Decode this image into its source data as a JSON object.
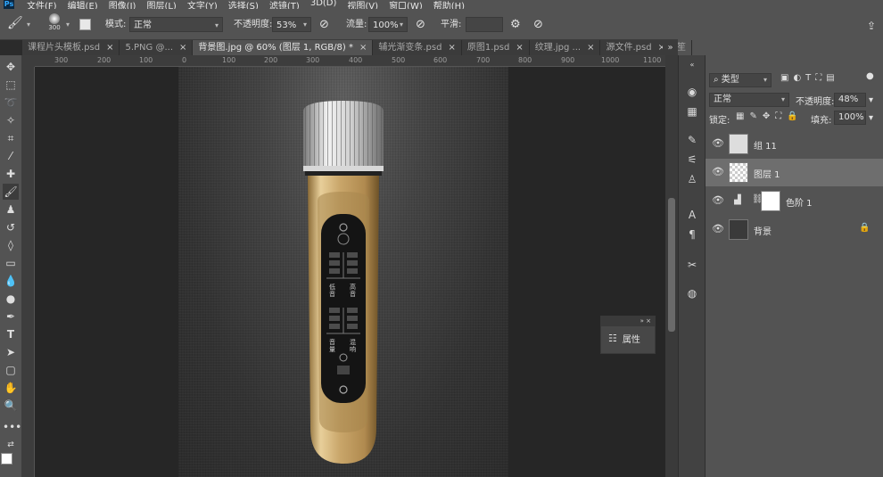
{
  "menubar": {
    "app_icon": "Ps",
    "items": [
      "文件(F)",
      "编辑(E)",
      "图像(I)",
      "图层(L)",
      "文字(Y)",
      "选择(S)",
      "滤镜(T)",
      "3D(D)",
      "视图(V)",
      "窗口(W)",
      "帮助(H)"
    ]
  },
  "options": {
    "brush_size": "300",
    "mode_label": "模式:",
    "mode_value": "正常",
    "opacity_label": "不透明度:",
    "opacity_value": "53%",
    "flow_label": "流量:",
    "flow_value": "100%",
    "smooth_label": "平滑:"
  },
  "tabs": [
    {
      "label": "课程片头模板.psd"
    },
    {
      "label": "5.PNG @..."
    },
    {
      "label": "背景图.jpg @ 60% (图层 1, RGB/8) *",
      "active": true
    },
    {
      "label": "辅光渐变条.psd"
    },
    {
      "label": "原图1.psd"
    },
    {
      "label": "纹理.jpg ..."
    },
    {
      "label": "源文件.psd"
    },
    {
      "label": "笙"
    }
  ],
  "ruler_top_labels": [
    "300",
    "200",
    "100",
    "0",
    "100",
    "200",
    "300",
    "400",
    "500",
    "600",
    "700",
    "800",
    "900",
    "1000",
    "1100"
  ],
  "properties_panel": {
    "label": "属性"
  },
  "layers_panel": {
    "filter_label": "类型",
    "blend_mode": "正常",
    "opacity_label": "不透明度:",
    "opacity_value": "48%",
    "lock_label": "锁定:",
    "fill_label": "填充:",
    "fill_value": "100%",
    "layers": [
      {
        "name": "组 11"
      },
      {
        "name": "图层 1",
        "selected": true
      },
      {
        "name": "色阶 1"
      },
      {
        "name": "背景"
      }
    ]
  },
  "device": {
    "labels": [
      "低",
      "音",
      "高",
      "音",
      "音",
      "量",
      "混",
      "响"
    ]
  },
  "colors": {
    "ui_dark": "#535353",
    "panel_bg": "#424242",
    "canvas_bg": "#262626",
    "gold": "#c8a46a"
  }
}
